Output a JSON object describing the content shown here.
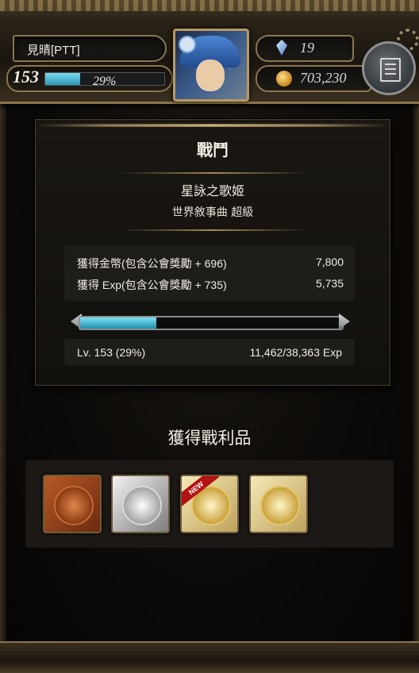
{
  "header": {
    "player_name": "見晴[PTT]",
    "level": "153",
    "exp_percent_label": "29%",
    "exp_fraction": 0.29,
    "gems": "19",
    "coins": "703,230",
    "avatar_icon": "character-portrait",
    "menu_icon": "menu-book-icon"
  },
  "result": {
    "title": "戰鬥",
    "stage_name": "星詠之歌姬",
    "stage_subtitle": "世界敘事曲 超級",
    "rewards": [
      {
        "label": "獲得金幣(包含公會獎勵 + 696)",
        "amount": "7,800"
      },
      {
        "label": "獲得 Exp(包含公會獎勵 + 735)",
        "amount": "5,735"
      }
    ],
    "exp_bar_fraction": 0.29,
    "level_text": "Lv. 153 (29%)",
    "exp_text": "11,462/38,363 Exp"
  },
  "loot": {
    "title": "獲得戰利品",
    "items": [
      {
        "type": "bronze-medal",
        "new": false
      },
      {
        "type": "silver-medal",
        "new": false
      },
      {
        "type": "gold-medal",
        "new": true
      },
      {
        "type": "gold-medal",
        "new": false
      }
    ],
    "new_label": "NEW"
  },
  "colors": {
    "accent_gold": "#8a7650",
    "exp_bar": "#2a9ab8",
    "new_badge": "#b31212"
  }
}
